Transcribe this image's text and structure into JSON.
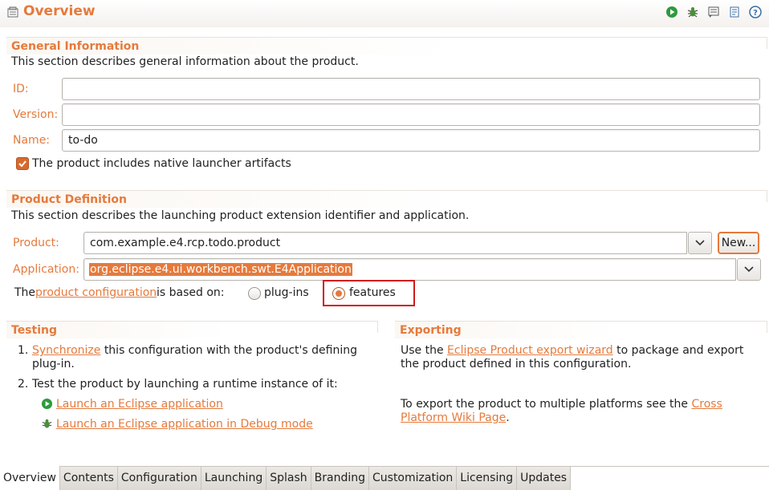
{
  "header": {
    "title": "Overview",
    "icons": [
      "overview-page-icon",
      "run-icon",
      "debug-icon",
      "export-icon",
      "sync-icon",
      "help-icon"
    ]
  },
  "general": {
    "title": "General Information",
    "description": "This section describes general information about the product.",
    "id_label": "ID:",
    "id_value": "",
    "version_label": "Version:",
    "version_value": "",
    "name_label": "Name:",
    "name_value": "to-do",
    "native_launcher_label": "The product includes native launcher artifacts",
    "native_launcher_checked": true
  },
  "product": {
    "title": "Product Definition",
    "description": "This section describes the launching product extension identifier and application.",
    "product_label": "Product:",
    "product_value": "com.example.e4.rcp.todo.product",
    "new_button": "New...",
    "application_label": "Application:",
    "application_value": "org.eclipse.e4.ui.workbench.swt.E4Application",
    "config_prefix": "The",
    "config_link": "product configuration",
    "config_suffix": "is based on:",
    "option_plugins": "plug-ins",
    "option_features": "features",
    "selected_option": "features"
  },
  "testing": {
    "title": "Testing",
    "step1_num": "1.",
    "step1_link": "Synchronize",
    "step1_text": "this configuration with the product's defining plug-in.",
    "step2_num": "2.",
    "step2_text": "Test the product by launching a runtime instance of it:",
    "launch_link": "Launch an Eclipse application",
    "debug_link": "Launch an Eclipse application in Debug mode"
  },
  "exporting": {
    "title": "Exporting",
    "text1_prefix": "Use the",
    "text1_link": "Eclipse Product export wizard",
    "text1_suffix": "to package and export the product defined in this configuration.",
    "text2_prefix": "To export the product to multiple platforms see the",
    "text2_link": "Cross Platform Wiki Page",
    "text2_suffix": "."
  },
  "tabs": [
    "Overview",
    "Contents",
    "Configuration",
    "Launching",
    "Splash",
    "Branding",
    "Customization",
    "Licensing",
    "Updates"
  ],
  "active_tab": "Overview",
  "colors": {
    "accent": "#e57a3c",
    "highlight": "#d11a1a"
  }
}
